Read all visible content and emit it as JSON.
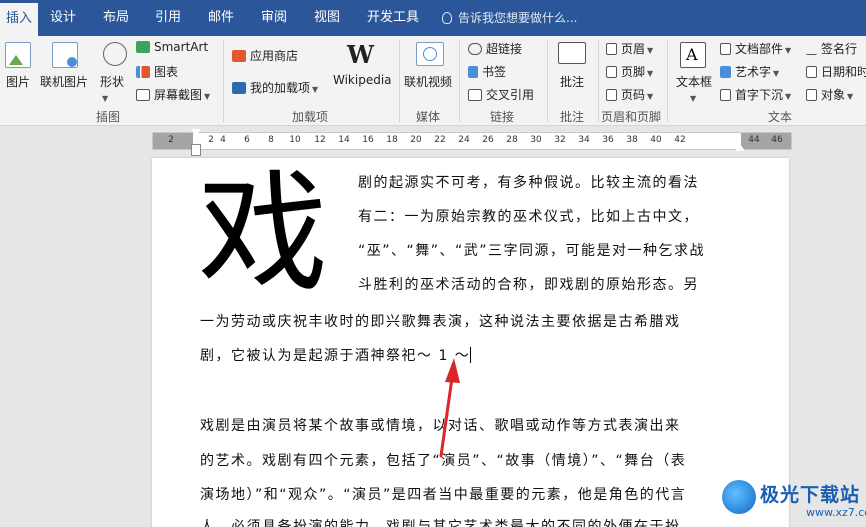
{
  "tabs": [
    "插入",
    "设计",
    "布局",
    "引用",
    "邮件",
    "审阅",
    "视图",
    "开发工具"
  ],
  "tell_me": "告诉我您想要做什么...",
  "ribbon": {
    "picture": "图片",
    "online_picture": "联机图片",
    "shapes": "形状",
    "smartart": "SmartArt",
    "chart": "图表",
    "screenshot": "屏幕截图",
    "group_illustrations": "插图",
    "app_store": "应用商店",
    "my_addins": "我的加载项",
    "wikipedia": "Wikipedia",
    "group_addins": "加载项",
    "online_video": "联机视频",
    "group_media": "媒体",
    "hyperlink": "超链接",
    "bookmark": "书签",
    "cross_reference": "交叉引用",
    "group_links": "链接",
    "comment": "批注",
    "group_comments": "批注",
    "header": "页眉",
    "footer": "页脚",
    "page_number": "页码",
    "group_header_footer": "页眉和页脚",
    "text_box": "文本框",
    "quick_parts": "文档部件",
    "wordart": "艺术字",
    "drop_cap": "首字下沉",
    "signature_line": "签名行",
    "date_time": "日期和时",
    "object": "对象",
    "group_text": "文本"
  },
  "ruler_numbers": [
    "2",
    "2",
    "4",
    "6",
    "8",
    "10",
    "12",
    "14",
    "16",
    "18",
    "20",
    "22",
    "24",
    "26",
    "28",
    "30",
    "32",
    "34",
    "36",
    "38",
    "40",
    "42",
    "44",
    "46"
  ],
  "doc": {
    "drop_cap": "戏",
    "lines": [
      "剧的起源实不可考，有多种假说。比较主流的看法",
      "有二：一为原始宗教的巫术仪式，比如上古中文，",
      "“巫”、“舞”、“武”三字同源，可能是对一种乞求战",
      "斗胜利的巫术活动的合称，即戏剧的原始形态。另",
      "一为劳动或庆祝丰收时的即兴歌舞表演，这种说法主要依据是古希腊戏",
      "剧，它被认为是起源于酒神祭祀～ 1 ～",
      "戏剧是由演员将某个故事或情境，以对话、歌唱或动作等方式表演出来",
      "的艺术。戏剧有四个元素，包括了“演员”、“故事（情境）”、“舞台（表",
      "演场地）”和“观众”。“演员”是四者当中最重要的元素，他是角色的代言",
      "人，必须具备扮演的能力，戏剧与其它艺术类最大的不同的外便在于扮"
    ]
  },
  "watermark": {
    "name": "极光下载站",
    "url": "www.xz7.com"
  },
  "colors": {
    "brand_blue": "#2b579a",
    "arrow_red": "#d9262a"
  }
}
